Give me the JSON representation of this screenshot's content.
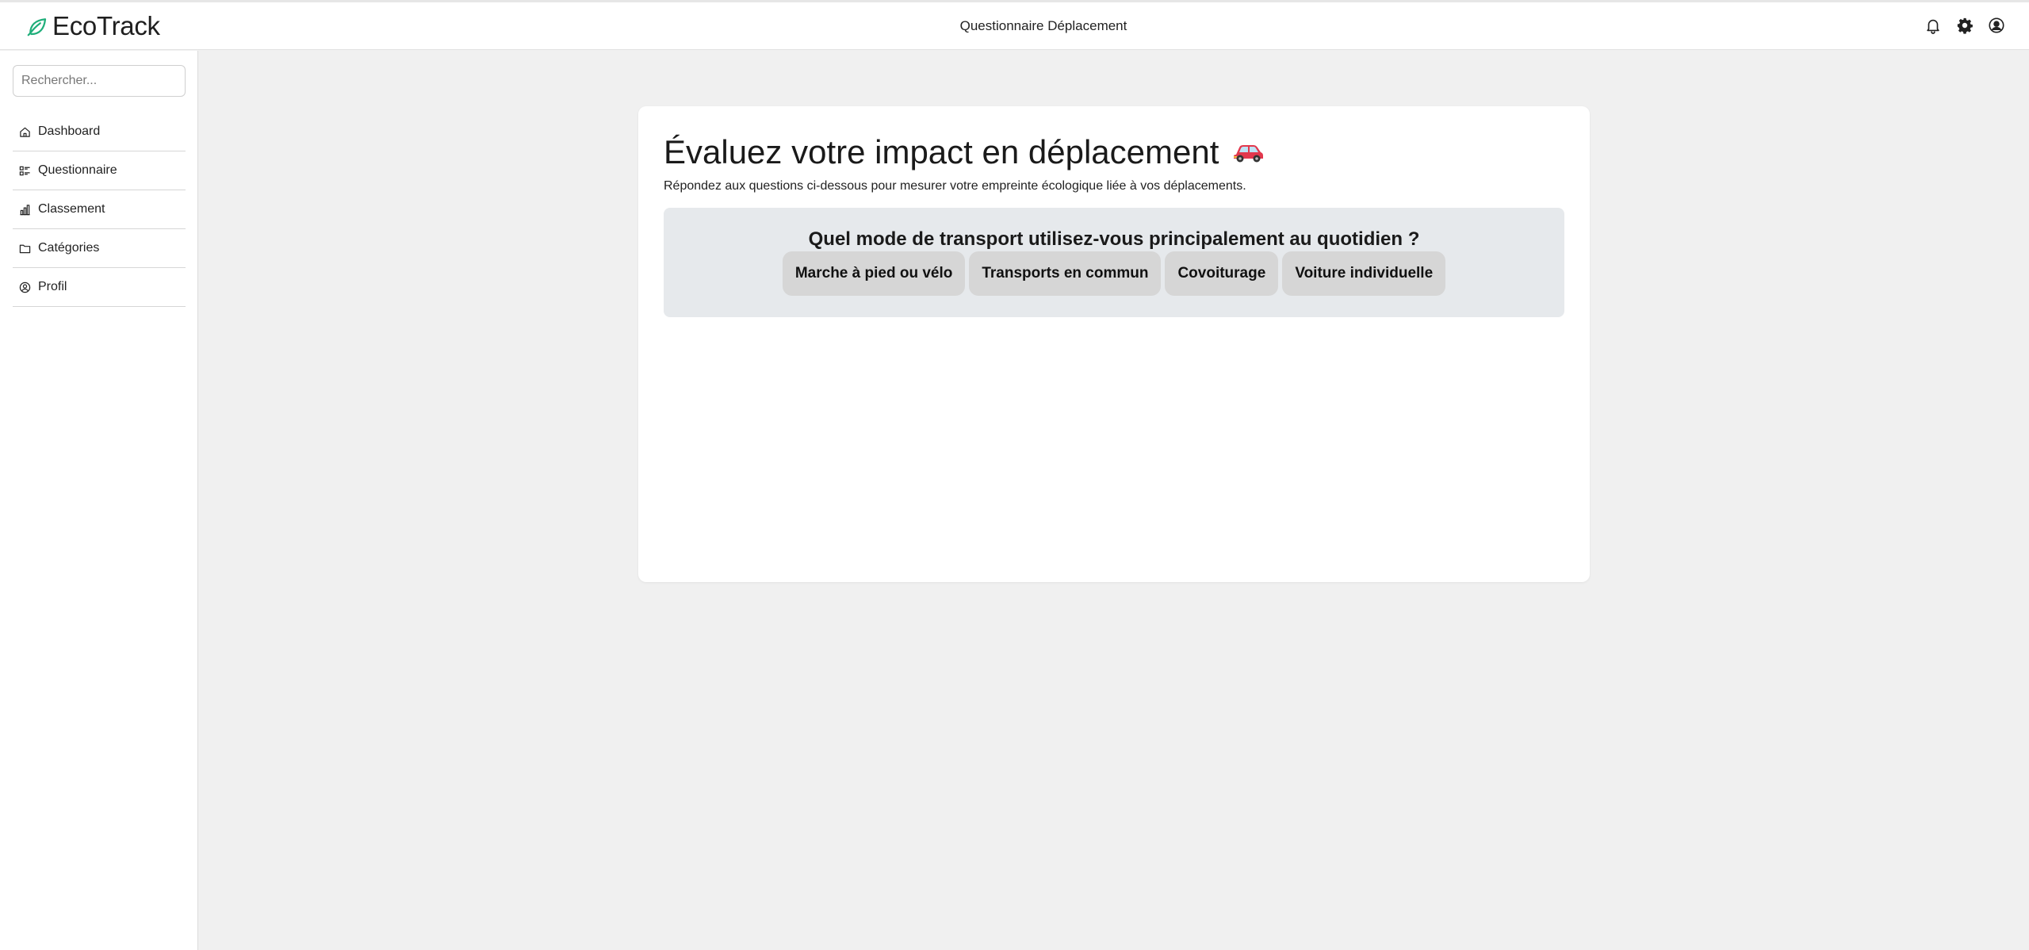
{
  "header": {
    "brand": "EcoTrack",
    "title": "Questionnaire Déplacement",
    "icons": [
      "bell-icon",
      "gear-icon",
      "user-circle-icon"
    ]
  },
  "sidebar": {
    "search_placeholder": "Rechercher...",
    "items": [
      {
        "label": "Dashboard",
        "icon": "home-icon"
      },
      {
        "label": "Questionnaire",
        "icon": "list-icon"
      },
      {
        "label": "Classement",
        "icon": "bar-chart-icon"
      },
      {
        "label": "Catégories",
        "icon": "folder-icon"
      },
      {
        "label": "Profil",
        "icon": "user-circle-icon"
      }
    ]
  },
  "main": {
    "title": "Évaluez votre impact en déplacement",
    "title_icon": "car-icon",
    "subtitle": "Répondez aux questions ci-dessous pour mesurer votre empreinte écologique liée à vos déplacements.",
    "question": "Quel mode de transport utilisez-vous principalement au quotidien ?",
    "options": [
      "Marche à pied ou vélo",
      "Transports en commun",
      "Covoiturage",
      "Voiture individuelle"
    ]
  },
  "colors": {
    "brand_accent": "#1fae7a",
    "page_background": "#f0f0f0",
    "question_box": "#e6e9ec",
    "option_button": "#d6d6d6"
  }
}
